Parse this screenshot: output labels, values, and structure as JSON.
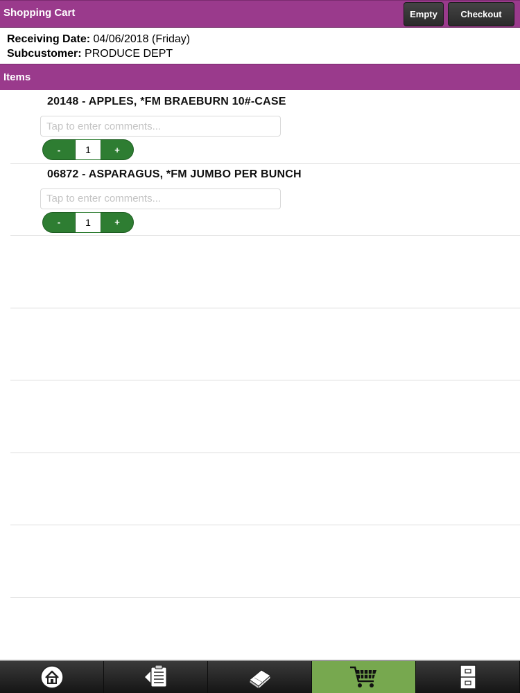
{
  "header": {
    "title": "Shopping Cart",
    "empty_label": "Empty",
    "checkout_label": "Checkout"
  },
  "info": {
    "receiving_date_label": "Receiving Date:",
    "receiving_date_value": "04/06/2018 (Friday)",
    "subcustomer_label": "Subcustomer:",
    "subcustomer_value": "PRODUCE DEPT"
  },
  "items_section": {
    "title": "Items"
  },
  "items": [
    {
      "title": "20148 - APPLES, *FM BRAEBURN 10#-CASE",
      "comment_placeholder": "Tap to enter comments...",
      "minus_label": "-",
      "quantity": "1",
      "plus_label": "+"
    },
    {
      "title": "06872 - ASPARAGUS, *FM JUMBO PER BUNCH",
      "comment_placeholder": "Tap to enter comments...",
      "minus_label": "-",
      "quantity": "1",
      "plus_label": "+"
    }
  ],
  "tabbar": {
    "tabs": [
      {
        "icon": "home-icon",
        "active": false
      },
      {
        "icon": "order-list-icon",
        "active": false
      },
      {
        "icon": "catalog-book-icon",
        "active": false
      },
      {
        "icon": "shopping-cart-icon",
        "active": true
      },
      {
        "icon": "file-cabinet-icon",
        "active": false
      }
    ]
  },
  "colors": {
    "header_purple": "#9a3a8c",
    "stepper_green": "#2e7d32",
    "active_tab_green": "#77a84f"
  }
}
